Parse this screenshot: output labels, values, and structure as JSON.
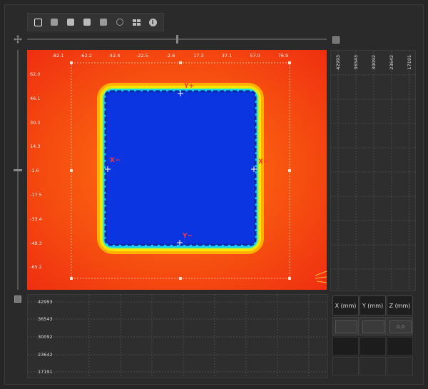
{
  "toolbar": {
    "buttons": [
      {
        "name": "select-tool",
        "icon": "square-outline-icon",
        "active": true
      },
      {
        "name": "add-roi",
        "icon": "add-roi-icon"
      },
      {
        "name": "plus",
        "icon": "plus-icon"
      },
      {
        "name": "minus",
        "icon": "minus-icon"
      },
      {
        "name": "fill",
        "icon": "filled-square-icon"
      },
      {
        "name": "target",
        "icon": "target-icon"
      },
      {
        "name": "layout",
        "icon": "grid-icon"
      },
      {
        "name": "info",
        "icon": "info-icon",
        "glyph": "i"
      }
    ]
  },
  "heatmap": {
    "x_ticks": [
      "-82.1",
      "-62.2",
      "-42.4",
      "-22.5",
      "-2.6",
      "17.3",
      "37.1",
      "57.0",
      "76.9"
    ],
    "y_ticks": [
      "62.0",
      "46.1",
      "30.2",
      "14.3",
      "-1.6",
      "-17.5",
      "-33.4",
      "-49.3",
      "-65.2"
    ],
    "labels": {
      "y_plus": "Y+",
      "y_minus": "Y−",
      "x_plus": "X+",
      "x_minus": "X−"
    },
    "colors": {
      "outer": "#f43a10",
      "inner": "#0a35e0",
      "edge": "#ffd200"
    }
  },
  "right_profile": {
    "labels": [
      "42993",
      "36543",
      "30092",
      "23642",
      "17191"
    ]
  },
  "bottom_profile": {
    "labels": [
      "42993",
      "36543",
      "30092",
      "23642",
      "17191"
    ]
  },
  "coord_table": {
    "headers": [
      "X (mm)",
      "Y (mm)",
      "Z (mm)"
    ],
    "z_value": "0.0"
  }
}
